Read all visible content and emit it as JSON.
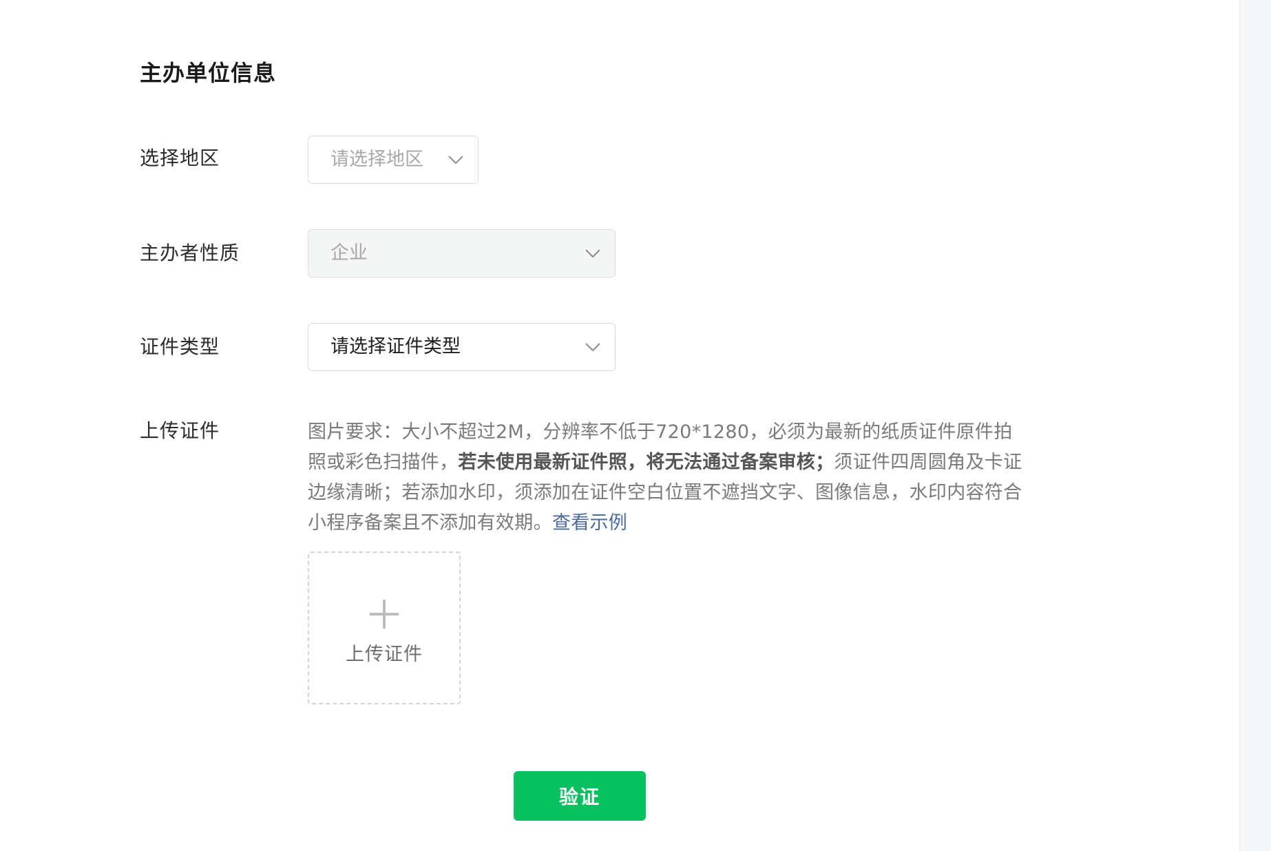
{
  "section": {
    "title": "主办单位信息"
  },
  "fields": {
    "region": {
      "label": "选择地区",
      "placeholder": "请选择地区"
    },
    "organizer_nature": {
      "label": "主办者性质",
      "value": "企业",
      "disabled": true
    },
    "certificate_type": {
      "label": "证件类型",
      "value": "请选择证件类型"
    },
    "upload": {
      "label": "上传证件",
      "requirement_prefix": "图片要求：大小不超过2M，分辨率不低于720*1280，必须为最新的纸质证件原件拍照或彩色扫描件，",
      "requirement_bold": "若未使用最新证件照，将无法通过备案审核；",
      "requirement_suffix": "须证件四周圆角及卡证边缘清晰；若添加水印，须添加在证件空白位置不遮挡文字、图像信息，水印内容符合小程序备案且不添加有效期。",
      "example_link": "查看示例",
      "button_label": "上传证件",
      "icon": "plus-icon"
    }
  },
  "actions": {
    "verify_label": "验证"
  },
  "colors": {
    "primary": "#07c160",
    "link": "#4a6a9b",
    "placeholder": "#a8a8a8",
    "border": "#dcdcdc",
    "disabled_bg": "#f4f5f5"
  }
}
